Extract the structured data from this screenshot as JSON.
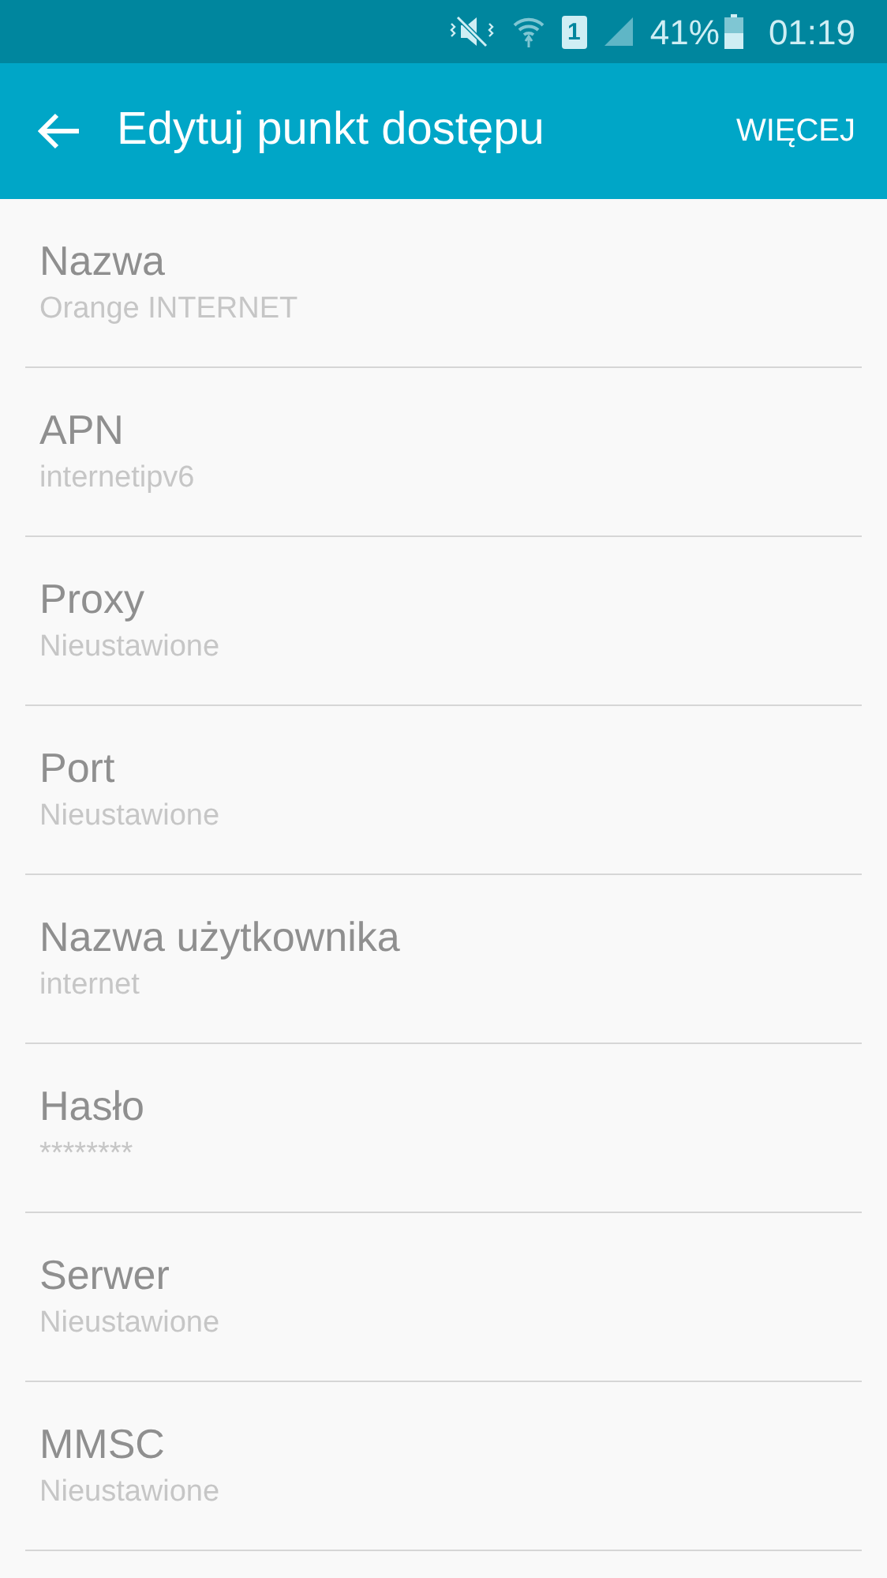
{
  "status_bar": {
    "sim_slot": "1",
    "battery": "41%",
    "time": "01:19"
  },
  "toolbar": {
    "title": "Edytuj punkt dostępu",
    "more": "WIĘCEJ"
  },
  "settings": [
    {
      "label": "Nazwa",
      "value": "Orange INTERNET"
    },
    {
      "label": "APN",
      "value": "internetipv6"
    },
    {
      "label": "Proxy",
      "value": "Nieustawione"
    },
    {
      "label": "Port",
      "value": "Nieustawione"
    },
    {
      "label": "Nazwa użytkownika",
      "value": "internet"
    },
    {
      "label": "Hasło",
      "value": "********"
    },
    {
      "label": "Serwer",
      "value": "Nieustawione"
    },
    {
      "label": "MMSC",
      "value": "Nieustawione"
    }
  ]
}
